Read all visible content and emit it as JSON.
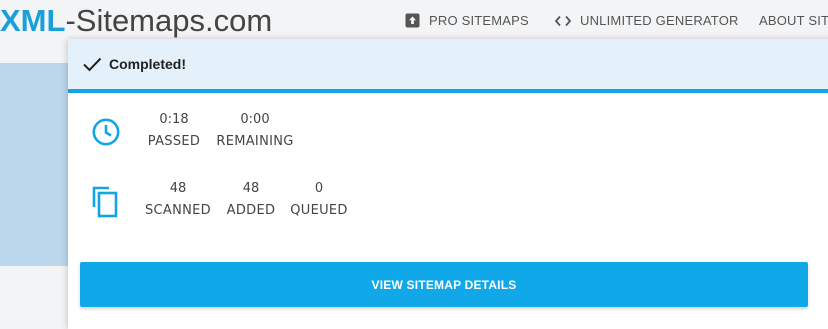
{
  "header": {
    "logo_primary": "XML",
    "logo_secondary": "-Sitemaps.com",
    "nav": [
      {
        "label": "PRO SITEMAPS",
        "icon": "upload-box-icon"
      },
      {
        "label": "UNLIMITED GENERATOR",
        "icon": "code-brackets-icon"
      },
      {
        "label": "ABOUT SITE"
      }
    ]
  },
  "modal": {
    "status": {
      "text": "Completed!",
      "icon": "check-icon"
    },
    "time_stats": {
      "icon": "clock-icon",
      "items": [
        {
          "value": "0:18",
          "label": "PASSED"
        },
        {
          "value": "0:00",
          "label": "REMAINING"
        }
      ]
    },
    "count_stats": {
      "icon": "copy-pages-icon",
      "items": [
        {
          "value": "48",
          "label": "SCANNED"
        },
        {
          "value": "48",
          "label": "ADDED"
        },
        {
          "value": "0",
          "label": "QUEUED"
        }
      ]
    },
    "cta_label": "VIEW SITEMAP DETAILS"
  },
  "colors": {
    "accent": "#12a4e4",
    "status_background": "#e4f1fb",
    "hero_background": "#bcd6ec",
    "page_background": "#f3f4f5"
  }
}
